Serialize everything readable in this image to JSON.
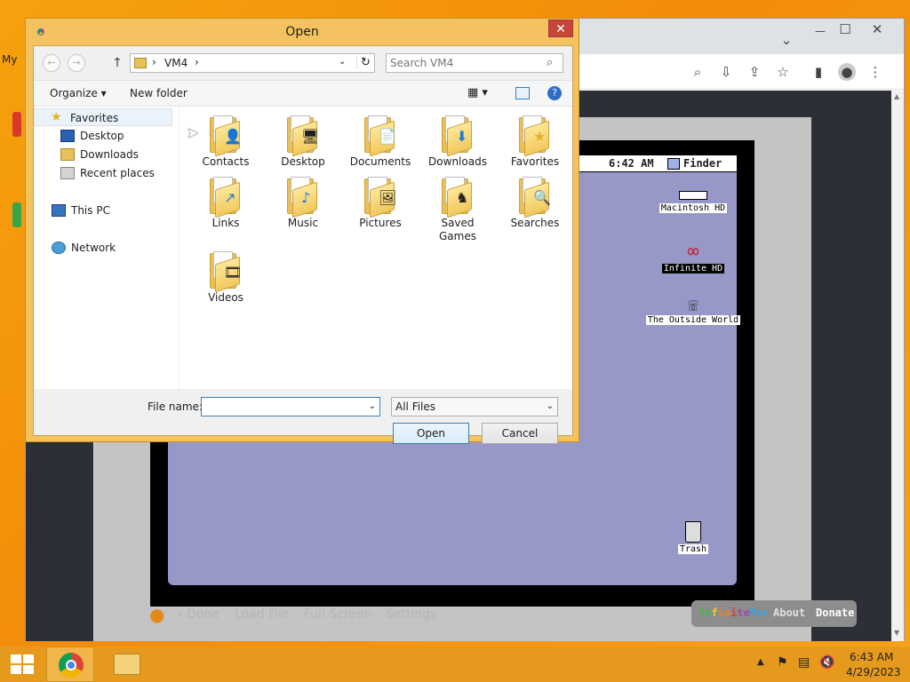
{
  "desktop": {
    "left_label": "My"
  },
  "chrome": {
    "window_controls": {
      "minimize": "—",
      "maximize": "☐",
      "close": "✕"
    }
  },
  "emulator": {
    "time": "6:42 AM",
    "finder": "Finder",
    "icons": [
      {
        "label": "Macintosh HD"
      },
      {
        "label": "Infinite HD"
      },
      {
        "label": "The Outside World"
      },
      {
        "label": "Trash"
      }
    ],
    "links": {
      "done": "‹ Done",
      "load_file": "Load File",
      "full_screen": "Full Screen",
      "settings": "Settings"
    },
    "brand": {
      "name_a": "In",
      "name_b": "f",
      "name_c": "in",
      "name_d": "i",
      "name_e": "te",
      "name_f": "Mac",
      "about": "About",
      "donate": "Donate"
    }
  },
  "dialog": {
    "title": "Open",
    "close": "✕",
    "address": {
      "crumb": "VM4",
      "sep": "›"
    },
    "search_placeholder": "Search VM4",
    "toolbar": {
      "organize": "Organize ▾",
      "new_folder": "New folder"
    },
    "nav": [
      {
        "label": "Favorites"
      },
      {
        "label": "Desktop"
      },
      {
        "label": "Downloads"
      },
      {
        "label": "Recent places"
      },
      {
        "label": "This PC"
      },
      {
        "label": "Network"
      }
    ],
    "files": [
      {
        "label": "Contacts",
        "glyph": "👤"
      },
      {
        "label": "Desktop",
        "glyph": "🖥"
      },
      {
        "label": "Documents",
        "glyph": "📄"
      },
      {
        "label": "Downloads",
        "glyph": "⬇"
      },
      {
        "label": "Favorites",
        "glyph": "★"
      },
      {
        "label": "Links",
        "glyph": "↗"
      },
      {
        "label": "Music",
        "glyph": "♪"
      },
      {
        "label": "Pictures",
        "glyph": "🖼"
      },
      {
        "label": "Saved Games",
        "glyph": "♞"
      },
      {
        "label": "Searches",
        "glyph": "🔍"
      },
      {
        "label": "Videos",
        "glyph": "🎞"
      }
    ],
    "file_name_label": "File name:",
    "file_name_value": "",
    "file_type": "All Files",
    "open_button": "Open",
    "cancel_button": "Cancel"
  },
  "taskbar": {
    "time": "6:43 AM",
    "date": "4/29/2023"
  }
}
